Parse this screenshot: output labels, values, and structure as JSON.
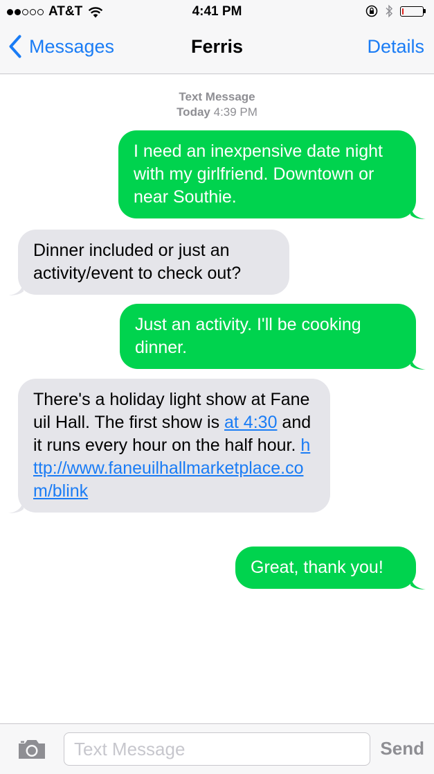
{
  "status_bar": {
    "carrier": "AT&T",
    "time": "4:41 PM",
    "signal_bars_filled": 2,
    "signal_bars_total": 5,
    "battery_level": 0.08,
    "battery_color": "#e0211c"
  },
  "nav": {
    "back_label": "Messages",
    "title": "Ferris",
    "details_label": "Details"
  },
  "timestamp": {
    "label": "Text Message",
    "day": "Today",
    "time": "4:39 PM"
  },
  "messages": [
    {
      "direction": "out",
      "text": "I need an inexpensive date night with my girlfriend. Downtown or near Southie."
    },
    {
      "direction": "in",
      "text": "Dinner included or just an activity/event to check out?"
    },
    {
      "direction": "out",
      "text": "Just an activity. I'll be cooking dinner."
    },
    {
      "direction": "in",
      "parts": [
        {
          "text": "There's a holiday light show at Faneuil Hall. The first show is "
        },
        {
          "text": "at 4:30",
          "link": true
        },
        {
          "text": " and it runs every hour on the half hour. "
        },
        {
          "text": "http://www.faneuilhallmarketplace.com/blink",
          "link": true
        }
      ]
    },
    {
      "direction": "out",
      "text": "Great, thank you!"
    }
  ],
  "input_bar": {
    "placeholder": "Text Message",
    "send_label": "Send"
  },
  "colors": {
    "accent": "#1a7cf5",
    "outgoing_bubble": "#00d34e",
    "incoming_bubble": "#e5e5ea"
  },
  "icons": {
    "back": "chevron-left-icon",
    "camera": "camera-icon",
    "wifi": "wifi-icon",
    "lock_rotation": "orientation-lock-icon",
    "bluetooth": "bluetooth-icon",
    "battery": "battery-icon"
  }
}
